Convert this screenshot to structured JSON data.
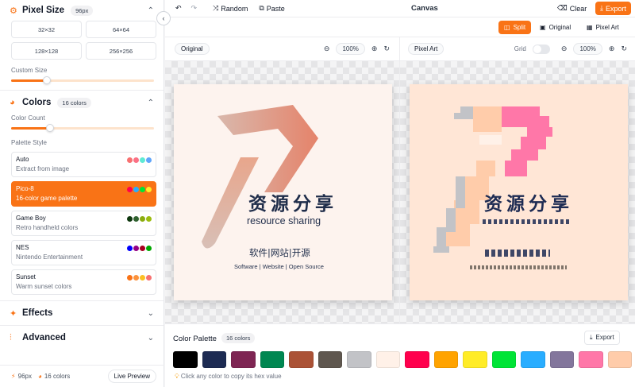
{
  "sidebar": {
    "pixel_size": {
      "title": "Pixel Size",
      "badge": "96px",
      "sizes": [
        "32×32",
        "64×64",
        "128×128",
        "256×256"
      ],
      "custom_label": "Custom Size",
      "custom_value": 0.25
    },
    "colors": {
      "title": "Colors",
      "badge": "16 colors",
      "count_label": "Color Count",
      "count_value": 0.27,
      "style_label": "Palette Style",
      "palettes": [
        {
          "name": "Auto",
          "desc": "Extract from image",
          "colors": [
            "#f87171",
            "#fb7185",
            "#5eead4",
            "#60a5fa"
          ],
          "active": false
        },
        {
          "name": "Pico-8",
          "desc": "16-color game palette",
          "colors": [
            "#ff004d",
            "#29adff",
            "#00e436",
            "#ffec27"
          ],
          "active": true
        },
        {
          "name": "Game Boy",
          "desc": "Retro handheld colors",
          "colors": [
            "#0f380f",
            "#306230",
            "#8bac0f",
            "#9bbc0f"
          ],
          "active": false
        },
        {
          "name": "NES",
          "desc": "Nintendo Entertainment",
          "colors": [
            "#0000fc",
            "#940084",
            "#a80020",
            "#00a800"
          ],
          "active": false
        },
        {
          "name": "Sunset",
          "desc": "Warm sunset colors",
          "colors": [
            "#f97316",
            "#fb923c",
            "#fbbf24",
            "#f87171"
          ],
          "active": false
        }
      ]
    },
    "effects": {
      "title": "Effects"
    },
    "advanced": {
      "title": "Advanced"
    },
    "status": {
      "size": "96px",
      "colors": "16 colors",
      "live_preview": "Live Preview"
    }
  },
  "topbar": {
    "undo_icon": "undo-icon",
    "redo_icon": "redo-icon",
    "random": "Random",
    "paste": "Paste",
    "title": "Canvas",
    "clear": "Clear",
    "export": "Export"
  },
  "viewbar": {
    "split": "Split",
    "original": "Original",
    "pixel_art": "Pixel Art",
    "active": "split"
  },
  "original_panel": {
    "label": "Original",
    "zoom": "100%",
    "card": {
      "title_cn": "资源分享",
      "subtitle": "resource sharing",
      "links_cn": "软件|网站|开源",
      "links_en": "Software | Website | Open Source"
    }
  },
  "pixel_panel": {
    "label": "Pixel Art",
    "grid_label": "Grid",
    "grid_on": false,
    "zoom": "100%",
    "title_cn": "资源分享"
  },
  "palette": {
    "title": "Color Palette",
    "badge": "16 colors",
    "export": "Export",
    "swatches": [
      "#000000",
      "#1d2b53",
      "#7e2553",
      "#008751",
      "#ab5236",
      "#5f574f",
      "#c2c3c7",
      "#fff1e8",
      "#ff004d",
      "#ffa300",
      "#ffec27",
      "#00e436",
      "#29adff",
      "#83769c",
      "#ff77a8",
      "#ffccaa"
    ],
    "hint": "Click any color to copy its hex value"
  },
  "colors": {
    "accent": "#f97316",
    "ink": "#1f2d4a"
  }
}
